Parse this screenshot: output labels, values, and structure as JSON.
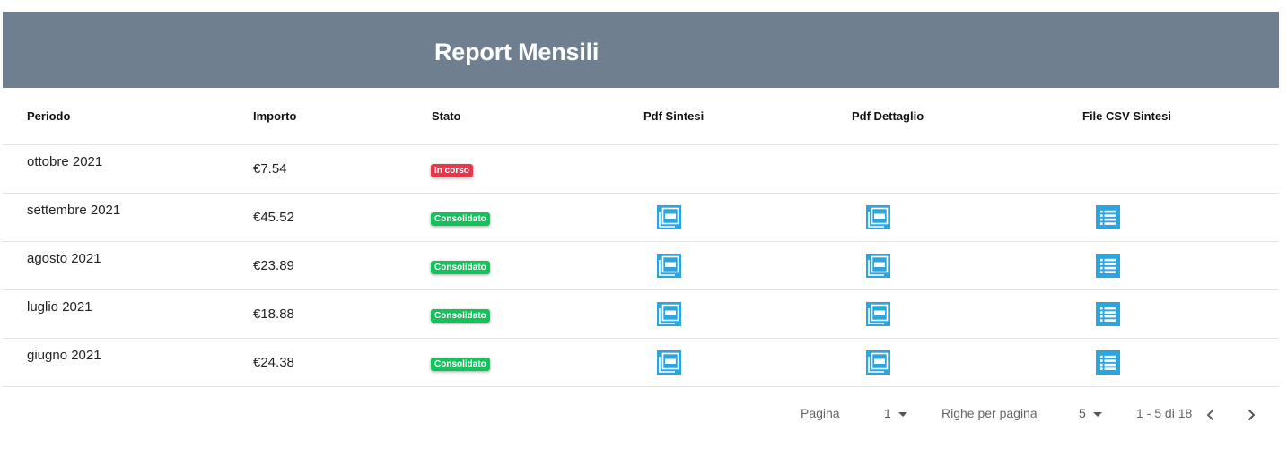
{
  "header": {
    "title": "Report Mensili"
  },
  "table": {
    "columns": [
      "Periodo",
      "Importo",
      "Stato",
      "Pdf Sintesi",
      "Pdf Dettaglio",
      "File CSV Sintesi"
    ],
    "rows": [
      {
        "period": "ottobre 2021",
        "amount": "€7.54",
        "status": "In corso",
        "status_color": "#e8364a",
        "has_files": false
      },
      {
        "period": "settembre 2021",
        "amount": "€45.52",
        "status": "Consolidato",
        "status_color": "#12c25a",
        "has_files": true
      },
      {
        "period": "agosto 2021",
        "amount": "€23.89",
        "status": "Consolidato",
        "status_color": "#12c25a",
        "has_files": true
      },
      {
        "period": "luglio 2021",
        "amount": "€18.88",
        "status": "Consolidato",
        "status_color": "#12c25a",
        "has_files": true
      },
      {
        "period": "giugno 2021",
        "amount": "€24.38",
        "status": "Consolidato",
        "status_color": "#12c25a",
        "has_files": true
      }
    ]
  },
  "icons": {
    "pdf": "pdf-icon",
    "csv": "list-icon",
    "accent": "#29a6e0"
  },
  "pagination": {
    "page_label": "Pagina",
    "page_value": "1",
    "rows_label": "Righe per pagina",
    "rows_value": "5",
    "range": "1 - 5 di 18"
  }
}
